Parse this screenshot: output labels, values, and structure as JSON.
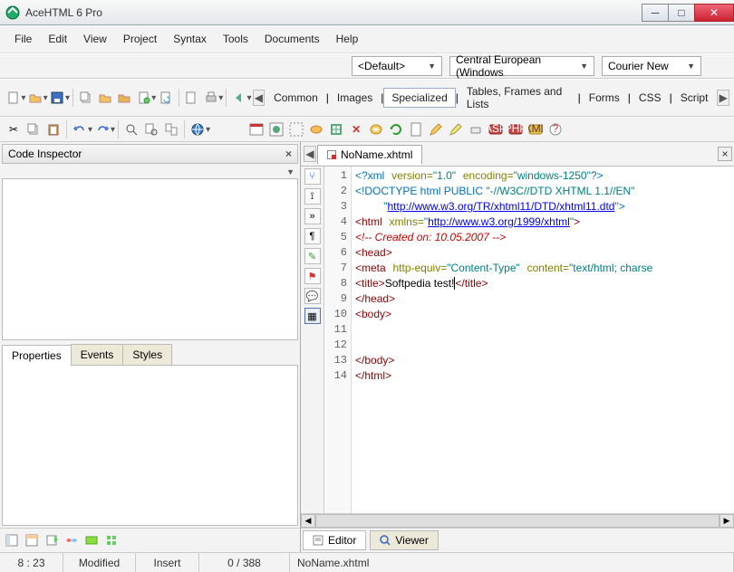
{
  "window": {
    "title": "AceHTML 6 Pro"
  },
  "menu": [
    "File",
    "Edit",
    "View",
    "Project",
    "Syntax",
    "Tools",
    "Documents",
    "Help"
  ],
  "combos": {
    "profile": "<Default>",
    "encoding": "Central European (Windows",
    "font": "Courier New"
  },
  "toolbar_tabs": [
    "Common",
    "Images",
    "Specialized",
    "Tables, Frames and Lists",
    "Forms",
    "CSS",
    "Script"
  ],
  "toolbar_tabs_active_index": 2,
  "inspector": {
    "title": "Code Inspector",
    "tabs": [
      "Properties",
      "Events",
      "Styles"
    ],
    "active": 0
  },
  "document": {
    "tab": "NoName.xhtml"
  },
  "code_lines": [
    {
      "n": 1,
      "html": "<span class='c-decl'>&lt;?xml</span> <span class='c-attr'>version=</span><span class='c-str'>\"1.0\"</span> <span class='c-attr'>encoding=</span><span class='c-str'>\"windows-1250\"</span><span class='c-decl'>?&gt;</span>"
    },
    {
      "n": 2,
      "html": "<span class='c-decl'>&lt;!DOCTYPE html PUBLIC </span><span class='c-str'>\"-//W3C//DTD XHTML 1.1//EN\"</span>"
    },
    {
      "n": 3,
      "html": "    <span class='c-str'>\"</span><span class='c-link'>http://www.w3.org/TR/xhtml11/DTD/xhtml11.dtd</span><span class='c-str'>\"</span><span class='c-decl'>&gt;</span>"
    },
    {
      "n": 4,
      "html": "<span class='c-tag'>&lt;html</span> <span class='c-attr'>xmlns=</span><span class='c-str'>\"</span><span class='c-link'>http://www.w3.org/1999/xhtml</span><span class='c-str'>\"</span><span class='c-tag'>&gt;</span>"
    },
    {
      "n": 5,
      "html": "<span class='c-cmt'>&lt;!-- Created on: 10.05.2007 --&gt;</span>"
    },
    {
      "n": 6,
      "html": "<span class='c-tag'>&lt;head&gt;</span>"
    },
    {
      "n": 7,
      "html": "<span class='c-tag'>&lt;meta</span> <span class='c-attr'>http-equiv=</span><span class='c-str'>\"Content-Type\"</span> <span class='c-attr'>content=</span><span class='c-str'>\"text/html; charse</span>"
    },
    {
      "n": 8,
      "html": "<span class='c-tag'>&lt;title&gt;</span><span class='c-txt'>Softpedia test!</span><span class='cursor'></span><span class='c-tag'>&lt;/title&gt;</span>"
    },
    {
      "n": 9,
      "html": "<span class='c-tag'>&lt;/head&gt;</span>"
    },
    {
      "n": 10,
      "html": "<span class='c-tag'>&lt;body&gt;</span>"
    },
    {
      "n": 11,
      "html": ""
    },
    {
      "n": 12,
      "html": ""
    },
    {
      "n": 13,
      "html": "<span class='c-tag'>&lt;/body&gt;</span>"
    },
    {
      "n": 14,
      "html": "<span class='c-tag'>&lt;/html&gt;</span>"
    }
  ],
  "view_tabs": [
    "Editor",
    "Viewer"
  ],
  "status": {
    "pos": "8 : 23",
    "state": "Modified",
    "mode": "Insert",
    "count": "0 / 388",
    "file": "NoName.xhtml"
  }
}
